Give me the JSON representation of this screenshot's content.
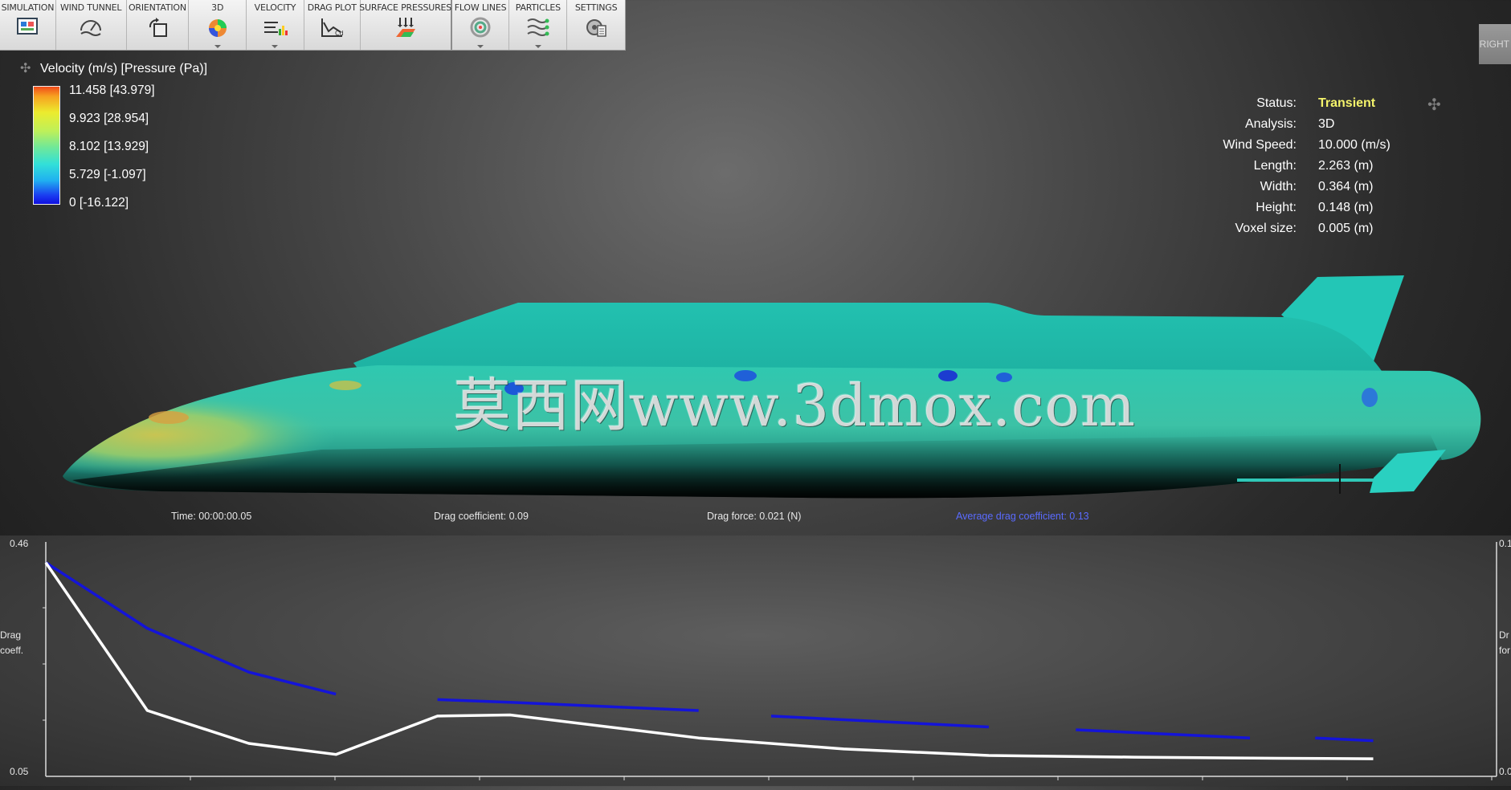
{
  "toolbar": {
    "items": [
      {
        "label": "SIMULATION",
        "icon": "simulation-icon"
      },
      {
        "label": "WIND TUNNEL",
        "icon": "wind-tunnel-icon"
      },
      {
        "label": "ORIENTATION",
        "icon": "orientation-icon"
      },
      {
        "label": "3D",
        "icon": "3d-view-icon"
      },
      {
        "label": "VELOCITY",
        "icon": "velocity-icon"
      },
      {
        "label": "DRAG PLOT",
        "icon": "drag-plot-icon"
      },
      {
        "label": "SURFACE PRESSURES",
        "icon": "surface-pressures-icon"
      },
      {
        "label": "FLOW LINES",
        "icon": "flow-lines-icon"
      },
      {
        "label": "PARTICLES",
        "icon": "particles-icon"
      },
      {
        "label": "SETTINGS",
        "icon": "settings-icon"
      }
    ],
    "right_view_label": "RIGHT"
  },
  "legend": {
    "title": "Velocity (m/s) [Pressure (Pa)]",
    "labels": [
      "11.458 [43.979]",
      "9.923 [28.954]",
      "8.102 [13.929]",
      "5.729 [-1.097]",
      "0 [-16.122]"
    ],
    "colors": [
      "#f04a1a",
      "#ecec2e",
      "#6ee89a",
      "#32e0d8",
      "#1010e0"
    ]
  },
  "status": {
    "rows": [
      {
        "key": "Status:",
        "value": "Transient"
      },
      {
        "key": "Analysis:",
        "value": "3D"
      },
      {
        "key": "Wind Speed:",
        "value": "10.000 (m/s)"
      },
      {
        "key": "Length:",
        "value": "2.263 (m)"
      },
      {
        "key": "Width:",
        "value": "0.364 (m)"
      },
      {
        "key": "Height:",
        "value": "0.148 (m)"
      },
      {
        "key": "Voxel size:",
        "value": "0.005 (m)"
      }
    ],
    "status_color": "#f4f36b"
  },
  "watermark": "莫西网www.3dmox.com",
  "info": {
    "time": "Time: 00:00:00.05",
    "drag_coefficient": "Drag coefficient: 0.09",
    "drag_force": "Drag force: 0.021 (N)",
    "average_drag_coefficient": "Average drag coefficient: 0.13"
  },
  "chart_data": {
    "type": "line",
    "ylabel_left": "Drag coeff.",
    "ylabel_right": "Dr for",
    "y_left_ticks": [
      "0.46",
      "0.05"
    ],
    "y_right_ticks": [
      "0.1",
      "0.0"
    ],
    "ylim": [
      0.05,
      0.46
    ],
    "series": [
      {
        "color": "#1414d8",
        "segments": [
          [
            [
              0.0,
              0.44
            ],
            [
              0.07,
              0.32
            ],
            [
              0.14,
              0.24
            ],
            [
              0.2,
              0.2
            ]
          ],
          [
            [
              0.27,
              0.19
            ],
            [
              0.32,
              0.185
            ],
            [
              0.45,
              0.17
            ]
          ],
          [
            [
              0.5,
              0.16
            ],
            [
              0.65,
              0.14
            ]
          ],
          [
            [
              0.71,
              0.135
            ],
            [
              0.83,
              0.12
            ]
          ],
          [
            [
              0.875,
              0.12
            ],
            [
              0.915,
              0.115
            ]
          ]
        ]
      },
      {
        "color": "#ffffff",
        "segments": [
          [
            [
              0.0,
              0.44
            ],
            [
              0.07,
              0.17
            ],
            [
              0.14,
              0.11
            ],
            [
              0.2,
              0.09
            ],
            [
              0.27,
              0.16
            ],
            [
              0.32,
              0.162
            ],
            [
              0.45,
              0.12
            ],
            [
              0.55,
              0.1
            ],
            [
              0.65,
              0.088
            ],
            [
              0.75,
              0.085
            ],
            [
              0.85,
              0.083
            ],
            [
              0.915,
              0.082
            ]
          ]
        ]
      }
    ]
  }
}
